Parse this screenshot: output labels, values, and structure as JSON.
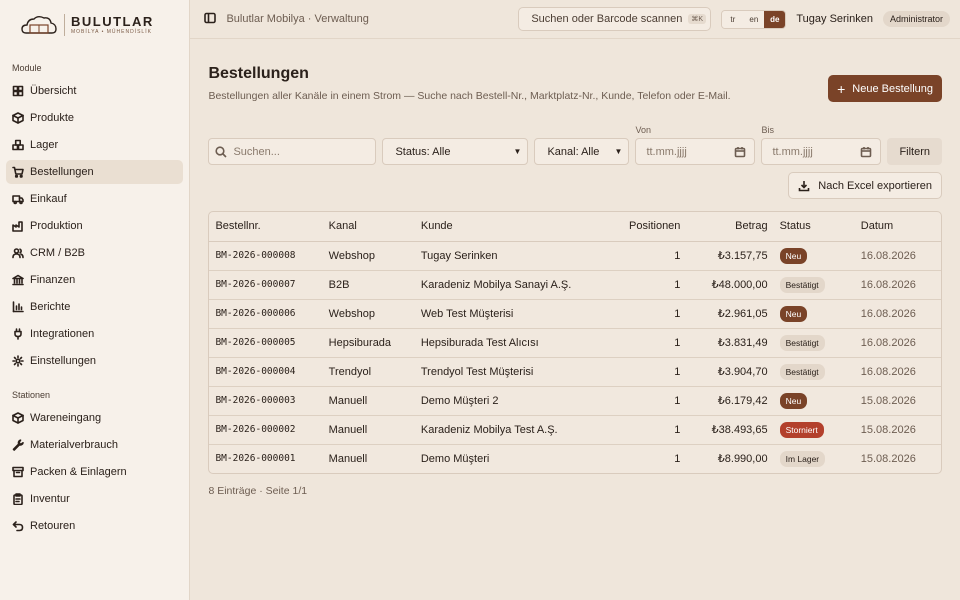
{
  "brand": {
    "name": "BULUTLAR",
    "sub": "MOBİLYA • MÜHENDİSLİK"
  },
  "sidebar": {
    "modules_label": "Module",
    "modules": [
      {
        "label": "Übersicht",
        "icon": "grid-icon"
      },
      {
        "label": "Produkte",
        "icon": "box-icon"
      },
      {
        "label": "Lager",
        "icon": "boxes-icon"
      },
      {
        "label": "Bestellungen",
        "icon": "cart-icon",
        "active": true
      },
      {
        "label": "Einkauf",
        "icon": "truck-icon"
      },
      {
        "label": "Produktion",
        "icon": "factory-icon"
      },
      {
        "label": "CRM / B2B",
        "icon": "users-icon"
      },
      {
        "label": "Finanzen",
        "icon": "bank-icon"
      },
      {
        "label": "Berichte",
        "icon": "bar-chart-icon"
      },
      {
        "label": "Integrationen",
        "icon": "plug-icon"
      },
      {
        "label": "Einstellungen",
        "icon": "gear-icon"
      }
    ],
    "stations_label": "Stationen",
    "stations": [
      {
        "label": "Wareneingang",
        "icon": "package-in-icon"
      },
      {
        "label": "Materialverbrauch",
        "icon": "wrench-icon"
      },
      {
        "label": "Packen & Einlagern",
        "icon": "archive-icon"
      },
      {
        "label": "Inventur",
        "icon": "clipboard-icon"
      },
      {
        "label": "Retouren",
        "icon": "return-icon"
      }
    ]
  },
  "topbar": {
    "breadcrumb": "Bulutlar Mobilya · Verwaltung",
    "search_placeholder": "Suchen oder Barcode scannen",
    "shortcut": "⌘K",
    "languages": [
      "tr",
      "en",
      "de"
    ],
    "active_language": "de",
    "user_name": "Tugay Serinken",
    "user_role": "Administrator"
  },
  "page": {
    "title": "Bestellungen",
    "subtitle": "Bestellungen aller Kanäle in einem Strom — Suche nach Bestell-Nr., Marktplatz-Nr., Kunde, Telefon oder E-Mail.",
    "new_button": "Neue Bestellung"
  },
  "filters": {
    "search_placeholder": "Suchen...",
    "status_value": "Status: Alle",
    "channel_value": "Kanal: Alle",
    "from_label": "Von",
    "to_label": "Bis",
    "date_placeholder": "tt.mm.jjjj",
    "filter_button": "Filtern",
    "export_button": "Nach Excel exportieren"
  },
  "table": {
    "columns": [
      "Bestellnr.",
      "Kanal",
      "Kunde",
      "Positionen",
      "Betrag",
      "Status",
      "Datum"
    ],
    "rows": [
      {
        "nr": "BM-2026-000008",
        "kanal": "Webshop",
        "kunde": "Tugay Serinken",
        "pos": "1",
        "betrag": "₺3.157,75",
        "status": "Neu",
        "datum": "16.08.2026"
      },
      {
        "nr": "BM-2026-000007",
        "kanal": "B2B",
        "kunde": "Karadeniz Mobilya Sanayi A.Ş.",
        "pos": "1",
        "betrag": "₺48.000,00",
        "status": "Bestätigt",
        "datum": "16.08.2026"
      },
      {
        "nr": "BM-2026-000006",
        "kanal": "Webshop",
        "kunde": "Web Test Müşterisi",
        "pos": "1",
        "betrag": "₺2.961,05",
        "status": "Neu",
        "datum": "16.08.2026"
      },
      {
        "nr": "BM-2026-000005",
        "kanal": "Hepsiburada",
        "kunde": "Hepsiburada Test Alıcısı",
        "pos": "1",
        "betrag": "₺3.831,49",
        "status": "Bestätigt",
        "datum": "16.08.2026"
      },
      {
        "nr": "BM-2026-000004",
        "kanal": "Trendyol",
        "kunde": "Trendyol Test Müşterisi",
        "pos": "1",
        "betrag": "₺3.904,70",
        "status": "Bestätigt",
        "datum": "16.08.2026"
      },
      {
        "nr": "BM-2026-000003",
        "kanal": "Manuell",
        "kunde": "Demo Müşteri 2",
        "pos": "1",
        "betrag": "₺6.179,42",
        "status": "Neu",
        "datum": "15.08.2026"
      },
      {
        "nr": "BM-2026-000002",
        "kanal": "Manuell",
        "kunde": "Karadeniz Mobilya Test A.Ş.",
        "pos": "1",
        "betrag": "₺38.493,65",
        "status": "Storniert",
        "datum": "15.08.2026"
      },
      {
        "nr": "BM-2026-000001",
        "kanal": "Manuell",
        "kunde": "Demo Müşteri",
        "pos": "1",
        "betrag": "₺8.990,00",
        "status": "Im Lager",
        "datum": "15.08.2026"
      }
    ]
  },
  "status_colors": {
    "Neu": {
      "bg": "#7a4328",
      "fg": "#ffffff"
    },
    "Bestätigt": {
      "bg": "#e3d7ca",
      "fg": "#2b211b"
    },
    "Storniert": {
      "bg": "#b3402c",
      "fg": "#ffffff"
    },
    "Im Lager": {
      "bg": "#e3d7ca",
      "fg": "#2b211b"
    }
  },
  "footer": "8 Einträge · Seite 1/1"
}
